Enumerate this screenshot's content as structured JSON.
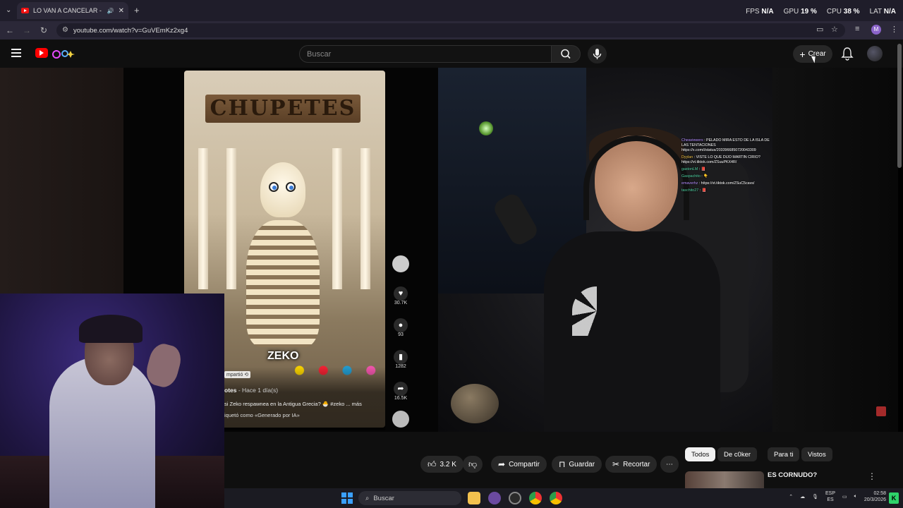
{
  "browser": {
    "tab_title": "LO VAN A CANCELAR - You",
    "new_tab": "+",
    "url": "youtube.com/watch?v=GuVEmKz2xg4",
    "profile_initial": "M"
  },
  "perf": {
    "fps_label": "FPS",
    "fps_value": "N/A",
    "gpu_label": "GPU",
    "gpu_value": "19 %",
    "cpu_label": "CPU",
    "cpu_value": "38 %",
    "lat_label": "LAT",
    "lat_value": "N/A"
  },
  "youtube": {
    "search_placeholder": "Buscar",
    "create_label": "Crear"
  },
  "tiktok": {
    "sign_text": "CHUPETES",
    "overlay_text": "ZEKO",
    "shared_label": "mpartió",
    "author": "otes",
    "time": " - Hace 1 día(s)",
    "description": "si Zeko respawnea en la Antigua Grecia? 🐣 #zeko ... más",
    "label": "iquetó como «Generado por IA»",
    "likes": "30.7K",
    "comments": "93",
    "saves": "1282",
    "shares": "16.5K"
  },
  "chat": [
    {
      "user": "Cheaviewers",
      "text": " : PELADO MIRA ESTO DE LA ISLA DE LAS TENTACIONES https://x.com/i/status/2033966850720043309",
      "cls": "u"
    },
    {
      "user": "Dyylan",
      "text": " : VISTE LO QUE DIJO MARTIN CIRIO? https://vt.tiktok.com/ZSuuPKX4R/",
      "cls": "u2"
    },
    {
      "user": "gastonLM",
      "text": " : 📕",
      "cls": "u3"
    },
    {
      "user": "Gaspachito",
      "text": " : 👇",
      "cls": "u3"
    },
    {
      "user": "emaverhz",
      "text": " : https://vt.tiktok.com/ZSuC5cavs/",
      "cls": "u"
    },
    {
      "user": "taschito27",
      "text": " : 📕",
      "cls": "u3"
    }
  ],
  "actions": {
    "like_count": "3.2 K",
    "share": "Compartir",
    "save": "Guardar",
    "clip": "Recortar",
    "more": "⋯"
  },
  "chips": [
    "Todos",
    "De c0ker",
    "Para ti",
    "Vistos"
  ],
  "recommendation": {
    "title": "ES CORNUDO?"
  },
  "taskbar": {
    "search": "Buscar",
    "lang_top": "ESP",
    "lang_bottom": "ES",
    "time": "02:58",
    "date": "20/3/2026",
    "badge": "K"
  }
}
